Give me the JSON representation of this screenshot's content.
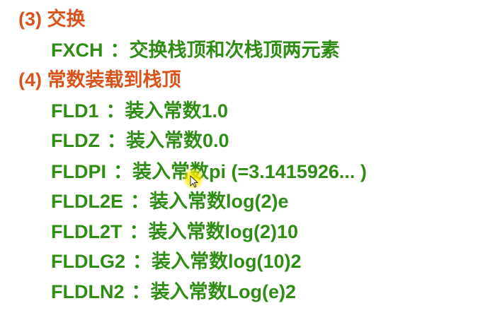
{
  "colors": {
    "heading": "#d9531b",
    "item": "#2f8c14",
    "background": "#ffffff",
    "cursor_highlight": "#ffeb00"
  },
  "sections": [
    {
      "heading": "(3) 交换",
      "items": [
        {
          "mnemonic": "FXCH",
          "desc": "：交换栈顶和次栈顶两元素"
        }
      ]
    },
    {
      "heading": "(4) 常数装载到栈顶",
      "items": [
        {
          "mnemonic": "FLD1",
          "desc": "：装入常数1.0"
        },
        {
          "mnemonic": "FLDZ",
          "desc": "：装入常数0.0"
        },
        {
          "mnemonic": "FLDPI",
          "desc": "：装入常数pi (=3.1415926... )"
        },
        {
          "mnemonic": "FLDL2E",
          "desc": "：装入常数log(2)e"
        },
        {
          "mnemonic": "FLDL2T",
          "desc": "：装入常数log(2)10"
        },
        {
          "mnemonic": "FLDLG2",
          "desc": "：装入常数log(10)2"
        },
        {
          "mnemonic": "FLDLN2",
          "desc": "：装入常数Log(e)2"
        }
      ]
    }
  ],
  "pointer_icon": "mouse-pointer-icon"
}
